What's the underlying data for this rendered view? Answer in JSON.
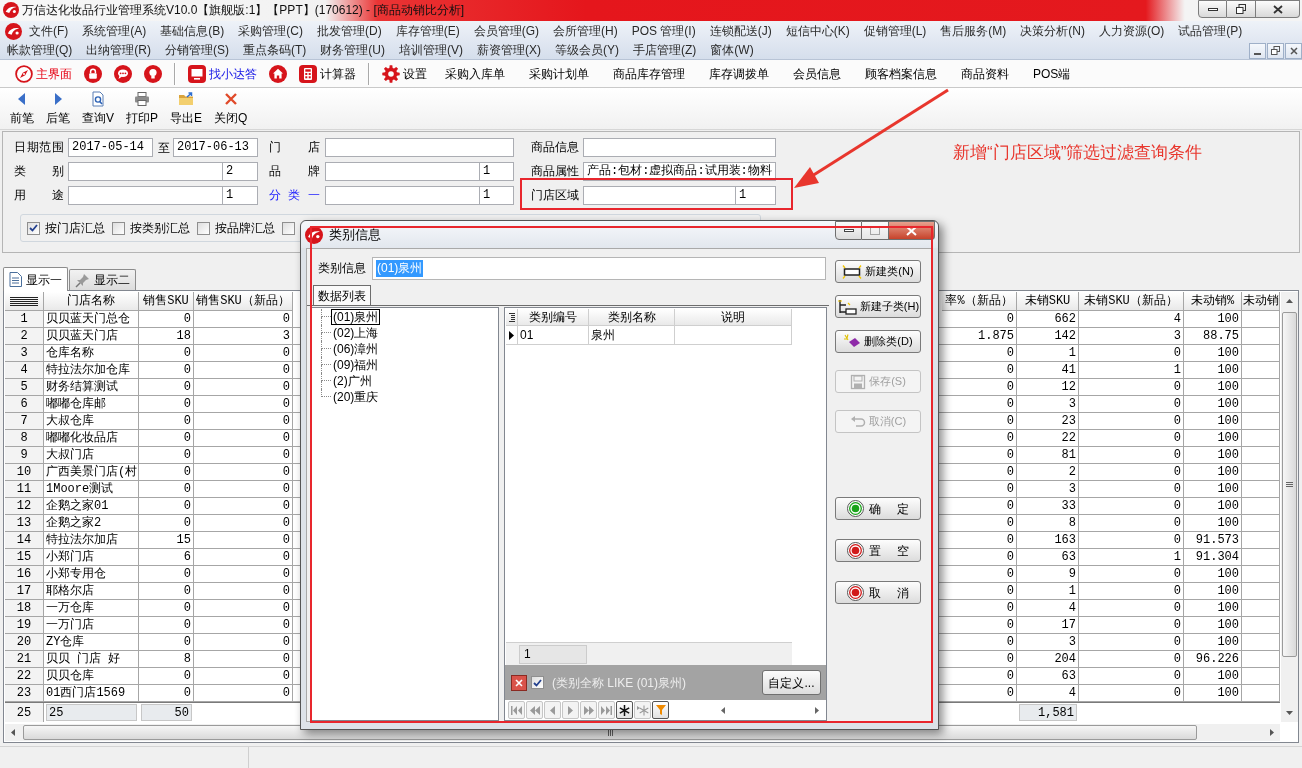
{
  "window": {
    "title": "万信达化妆品行业管理系统V10.0【旗舰版:1】【PPT】(170612) - [商品动销比分析]"
  },
  "menu_bar": {
    "rows": [
      [
        "文件(F)",
        "系统管理(A)",
        "基础信息(B)",
        "采购管理(C)",
        "批发管理(D)",
        "库存管理(E)",
        "会员管理(G)",
        "会所管理(H)",
        "POS 管理(I)",
        "连锁配送(J)",
        "短信中心(K)",
        "促销管理(L)",
        "售后服务(M)",
        "决策分析(N)",
        "人力资源(O)",
        "试品管理(P)"
      ],
      [
        "帐款管理(Q)",
        "出纳管理(R)",
        "分销管理(S)",
        "重点条码(T)",
        "财务管理(U)",
        "培训管理(V)",
        "薪资管理(X)",
        "等级会员(Y)",
        "手店管理(Z)",
        "窗体(W)"
      ]
    ]
  },
  "toolbar": [
    {
      "kind": "compass",
      "label": "主界面"
    },
    {
      "kind": "lock"
    },
    {
      "kind": "chat"
    },
    {
      "kind": "bulb"
    },
    {
      "kind": "separator"
    },
    {
      "kind": "monitor",
      "label": "找小达答"
    },
    {
      "kind": "home"
    },
    {
      "kind": "calculator",
      "label": "计算器"
    },
    {
      "kind": "separator"
    },
    {
      "kind": "gear",
      "label": "设置"
    },
    {
      "kind": "text",
      "label": "采购入库单"
    },
    {
      "kind": "text",
      "label": "采购计划单"
    },
    {
      "kind": "text",
      "label": "商品库存管理"
    },
    {
      "kind": "text",
      "label": "库存调拨单"
    },
    {
      "kind": "text",
      "label": "会员信息"
    },
    {
      "kind": "text",
      "label": "顾客档案信息"
    },
    {
      "kind": "text",
      "label": "商品资料"
    },
    {
      "kind": "text",
      "label": "POS端"
    }
  ],
  "action_bar": [
    {
      "kind": "prev",
      "label": "前笔"
    },
    {
      "kind": "next",
      "label": "后笔"
    },
    {
      "kind": "query",
      "label": "查询V"
    },
    {
      "kind": "print",
      "label": "打印P"
    },
    {
      "kind": "export",
      "label": "导出E"
    },
    {
      "kind": "close",
      "label": "关闭Q"
    }
  ],
  "filters": {
    "rows": [
      [
        {
          "kind": "date_range",
          "label": "日期范围",
          "from": "2017-05-14",
          "separator": "至",
          "to": "2017-06-13",
          "link": false,
          "annotated": false
        },
        {
          "kind": "text",
          "label": "门 店",
          "link": false,
          "annotated": false
        },
        {
          "kind": "text",
          "label": "商品信息",
          "link": false,
          "annotated": false
        }
      ],
      [
        {
          "kind": "split",
          "label": "类 别",
          "right_value": "2",
          "link": false,
          "annotated": false
        },
        {
          "kind": "split",
          "label": "品 牌",
          "right_value": "1",
          "link": false,
          "annotated": false
        },
        {
          "kind": "text",
          "label": "商品属性",
          "value": "产品:包材:虚拟商品:试用装:物料",
          "link": false,
          "annotated": false
        }
      ],
      [
        {
          "kind": "split",
          "label": "用 途",
          "right_value": "1",
          "link": false,
          "annotated": false
        },
        {
          "kind": "split",
          "label": "分 类 一",
          "right_value": "1",
          "link": true,
          "annotated": false
        },
        {
          "kind": "split",
          "label": "门店区域",
          "right_value": "1",
          "link": false,
          "annotated": true
        }
      ]
    ]
  },
  "summary_options": [
    {
      "label": "按门店汇总",
      "checked": true
    },
    {
      "label": "按类别汇总",
      "checked": false
    },
    {
      "label": "按品牌汇总",
      "checked": false
    },
    {
      "checked": false
    }
  ],
  "annotation": {
    "text": "新增“门店区域”筛选过滤查询条件"
  },
  "result_tabs": [
    {
      "kind": "document",
      "label": "显示一",
      "selected": true
    },
    {
      "kind": "tool",
      "label": "显示二",
      "selected": false
    }
  ],
  "table": {
    "columns": [
      "门店名称",
      "销售SKU",
      "销售SKU（新品）",
      "率%（新品）",
      "未销SKU",
      "未销SKU（新品）",
      "未动销%",
      "未动销"
    ],
    "rows": [
      {
        "no": "1",
        "cells": [
          "贝贝蓝天门总仓",
          "0",
          "0",
          "0",
          "662",
          "4",
          "100"
        ]
      },
      {
        "no": "2",
        "cells": [
          "贝贝蓝天门店",
          "18",
          "3",
          "1.875",
          "142",
          "3",
          "88.75"
        ]
      },
      {
        "no": "3",
        "cells": [
          "仓库名称",
          "0",
          "0",
          "0",
          "1",
          "0",
          "100"
        ]
      },
      {
        "no": "4",
        "cells": [
          "特拉法尔加仓库",
          "0",
          "0",
          "0",
          "41",
          "1",
          "100"
        ]
      },
      {
        "no": "5",
        "cells": [
          "财务结算测试",
          "0",
          "0",
          "0",
          "12",
          "0",
          "100"
        ]
      },
      {
        "no": "6",
        "cells": [
          "嘟嘟仓库邮",
          "0",
          "0",
          "0",
          "3",
          "0",
          "100"
        ]
      },
      {
        "no": "7",
        "cells": [
          "大叔仓库",
          "0",
          "0",
          "0",
          "23",
          "0",
          "100"
        ]
      },
      {
        "no": "8",
        "cells": [
          "嘟嘟化妆品店",
          "0",
          "0",
          "0",
          "22",
          "0",
          "100"
        ]
      },
      {
        "no": "9",
        "cells": [
          "大叔门店",
          "0",
          "0",
          "0",
          "81",
          "0",
          "100"
        ]
      },
      {
        "no": "10",
        "cells": [
          "广西美景门店(村",
          "0",
          "0",
          "0",
          "2",
          "0",
          "100"
        ]
      },
      {
        "no": "11",
        "cells": [
          "1Moore测试",
          "0",
          "0",
          "0",
          "3",
          "0",
          "100"
        ]
      },
      {
        "no": "12",
        "cells": [
          "企鹅之家01",
          "0",
          "0",
          "0",
          "33",
          "0",
          "100"
        ]
      },
      {
        "no": "13",
        "cells": [
          "企鹅之家2",
          "0",
          "0",
          "0",
          "8",
          "0",
          "100"
        ]
      },
      {
        "no": "14",
        "cells": [
          "特拉法尔加店",
          "15",
          "0",
          "0",
          "163",
          "0",
          "91.573"
        ]
      },
      {
        "no": "15",
        "cells": [
          "小郑门店",
          "6",
          "0",
          "0",
          "63",
          "1",
          "91.304"
        ]
      },
      {
        "no": "16",
        "cells": [
          "小郑专用仓",
          "0",
          "0",
          "0",
          "9",
          "0",
          "100"
        ]
      },
      {
        "no": "17",
        "cells": [
          "耶格尔店",
          "0",
          "0",
          "0",
          "1",
          "0",
          "100"
        ]
      },
      {
        "no": "18",
        "cells": [
          "一万仓库",
          "0",
          "0",
          "0",
          "4",
          "0",
          "100"
        ]
      },
      {
        "no": "19",
        "cells": [
          "一万门店",
          "0",
          "0",
          "0",
          "17",
          "0",
          "100"
        ]
      },
      {
        "no": "20",
        "cells": [
          "ZY仓库",
          "0",
          "0",
          "0",
          "3",
          "0",
          "100"
        ]
      },
      {
        "no": "21",
        "cells": [
          "贝贝 门店 好",
          "8",
          "0",
          "0",
          "204",
          "0",
          "96.226"
        ]
      },
      {
        "no": "22",
        "cells": [
          "贝贝仓库",
          "0",
          "0",
          "0",
          "63",
          "0",
          "100"
        ]
      },
      {
        "no": "23",
        "cells": [
          "01西门店1569",
          "0",
          "0",
          "0",
          "4",
          "0",
          "100"
        ]
      }
    ],
    "footer": {
      "no": "25",
      "store_count": "25",
      "sales_sku": "50",
      "unsold_sku": "1,581"
    }
  },
  "dialog": {
    "title": "类别信息",
    "highlighted": true,
    "field": {
      "label": "类别信息",
      "value": "(01)泉州",
      "selected": true
    },
    "tabs": [
      {
        "label": "数据列表",
        "selected": true
      }
    ],
    "tree": [
      {
        "label": "(01)泉州",
        "selected": true
      },
      {
        "label": "(02)上海",
        "selected": false
      },
      {
        "label": "(06)漳州",
        "selected": false
      },
      {
        "label": "(09)福州",
        "selected": false
      },
      {
        "label": "(2)广州",
        "selected": false
      },
      {
        "label": "(20)重庆",
        "selected": false
      }
    ],
    "grid": {
      "columns": [
        "类别编号",
        "类别名称",
        "说明"
      ],
      "rows": [
        {
          "current": true,
          "cells": [
            "01",
            "泉州"
          ]
        }
      ],
      "footer": "1"
    },
    "filter": {
      "checked": true,
      "text": "(类别全称 LIKE (01)泉州)",
      "button": "自定义..."
    },
    "navigator": [
      {
        "kind": "first",
        "disabled": true
      },
      {
        "kind": "prior_page",
        "disabled": true
      },
      {
        "kind": "prior",
        "disabled": true
      },
      {
        "kind": "next",
        "disabled": true
      },
      {
        "kind": "next_page",
        "disabled": true
      },
      {
        "kind": "last",
        "disabled": true
      },
      {
        "kind": "insert",
        "disabled": false
      },
      {
        "kind": "append",
        "disabled": true
      },
      {
        "kind": "filter",
        "disabled": false
      }
    ],
    "edit_buttons": [
      {
        "kind": "new_class",
        "label": "新建类(N)",
        "disabled": false
      },
      {
        "kind": "new_subclass",
        "label": "新建子类(H)",
        "disabled": false
      },
      {
        "kind": "delete",
        "label": "删除类(D)",
        "disabled": false
      },
      {
        "kind": "save",
        "label": "保存(S)",
        "disabled": true
      },
      {
        "kind": "undo",
        "label": "取消(C)",
        "disabled": true
      }
    ],
    "confirm_buttons": [
      {
        "kind": "confirm",
        "label": "确 定"
      },
      {
        "kind": "clear",
        "label": "置 空"
      },
      {
        "kind": "cancel",
        "label": "取 消"
      }
    ]
  }
}
